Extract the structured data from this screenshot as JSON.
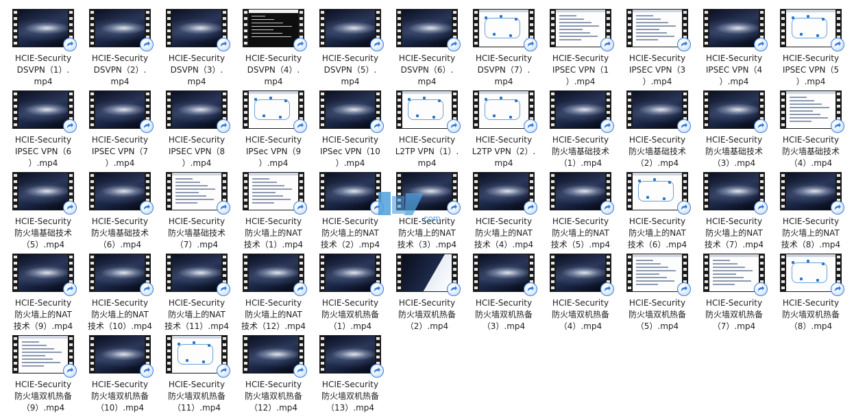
{
  "files": [
    {
      "lines": [
        "HCIE-Security",
        "DSVPN（1）.",
        "mp4"
      ],
      "thumb": "galaxy"
    },
    {
      "lines": [
        "HCIE-Security",
        "DSVPN（2）.",
        "mp4"
      ],
      "thumb": "galaxy"
    },
    {
      "lines": [
        "HCIE-Security",
        "DSVPN（3）.",
        "mp4"
      ],
      "thumb": "galaxy"
    },
    {
      "lines": [
        "HCIE-Security",
        "DSVPN（4）.",
        "mp4"
      ],
      "thumb": "terminal"
    },
    {
      "lines": [
        "HCIE-Security",
        "DSVPN（5）.",
        "mp4"
      ],
      "thumb": "galaxy"
    },
    {
      "lines": [
        "HCIE-Security",
        "DSVPN（6）.",
        "mp4"
      ],
      "thumb": "galaxy"
    },
    {
      "lines": [
        "HCIE-Security",
        "DSVPN（7）.",
        "mp4"
      ],
      "thumb": "diagram"
    },
    {
      "lines": [
        "HCIE-Security",
        "IPSEC VPN（1",
        "）.mp4"
      ],
      "thumb": "document"
    },
    {
      "lines": [
        "HCIE-Security",
        "IPSEC VPN（3",
        "）.mp4"
      ],
      "thumb": "document"
    },
    {
      "lines": [
        "HCIE-Security",
        "IPSEC VPN（4",
        "）.mp4"
      ],
      "thumb": "galaxy"
    },
    {
      "lines": [
        "HCIE-Security",
        "IPSEC VPN（5",
        "）.mp4"
      ],
      "thumb": "diagram"
    },
    {
      "lines": [
        "HCIE-Security",
        "IPSEC VPN（6",
        "）.mp4"
      ],
      "thumb": "galaxy"
    },
    {
      "lines": [
        "HCIE-Security",
        "IPSEC VPN（7",
        "）.mp4"
      ],
      "thumb": "galaxy"
    },
    {
      "lines": [
        "HCIE-Security",
        "IPSEC VPN（8",
        "）.mp4"
      ],
      "thumb": "galaxy"
    },
    {
      "lines": [
        "HCIE-Security",
        "IPSec VPN（9",
        "）.mp4"
      ],
      "thumb": "diagram"
    },
    {
      "lines": [
        "HCIE-Security",
        "IPSec VPN（10",
        "）.mp4"
      ],
      "thumb": "galaxy"
    },
    {
      "lines": [
        "HCIE-Security",
        "L2TP VPN（1）.",
        "mp4"
      ],
      "thumb": "diagram"
    },
    {
      "lines": [
        "HCIE-Security",
        "L2TP VPN（2）.",
        "mp4"
      ],
      "thumb": "diagram"
    },
    {
      "lines": [
        "HCIE-Security",
        "防火墙基础技术",
        "（1）.mp4"
      ],
      "thumb": "galaxy"
    },
    {
      "lines": [
        "HCIE-Security",
        "防火墙基础技术",
        "（2）.mp4"
      ],
      "thumb": "galaxy"
    },
    {
      "lines": [
        "HCIE-Security",
        "防火墙基础技术",
        "（3）.mp4"
      ],
      "thumb": "galaxy"
    },
    {
      "lines": [
        "HCIE-Security",
        "防火墙基础技术",
        "（4）.mp4"
      ],
      "thumb": "document"
    },
    {
      "lines": [
        "HCIE-Security",
        "防火墙基础技术",
        "（5）.mp4"
      ],
      "thumb": "galaxy"
    },
    {
      "lines": [
        "HCIE-Security",
        "防火墙基础技术",
        "（6）.mp4"
      ],
      "thumb": "galaxy"
    },
    {
      "lines": [
        "HCIE-Security",
        "防火墙基础技术",
        "（7）.mp4"
      ],
      "thumb": "document"
    },
    {
      "lines": [
        "HCIE-Security",
        "防火墙上的NAT",
        "技术（1）.mp4"
      ],
      "thumb": "document"
    },
    {
      "lines": [
        "HCIE-Security",
        "防火墙上的NAT",
        "技术（2）.mp4"
      ],
      "thumb": "galaxy"
    },
    {
      "lines": [
        "HCIE-Security",
        "防火墙上的NAT",
        "技术（3）.mp4"
      ],
      "thumb": "galaxy"
    },
    {
      "lines": [
        "HCIE-Security",
        "防火墙上的NAT",
        "技术（4）.mp4"
      ],
      "thumb": "galaxy"
    },
    {
      "lines": [
        "HCIE-Security",
        "防火墙上的NAT",
        "技术（5）.mp4"
      ],
      "thumb": "galaxy"
    },
    {
      "lines": [
        "HCIE-Security",
        "防火墙上的NAT",
        "技术（6）.mp4"
      ],
      "thumb": "diagram"
    },
    {
      "lines": [
        "HCIE-Security",
        "防火墙上的NAT",
        "技术（7）.mp4"
      ],
      "thumb": "galaxy"
    },
    {
      "lines": [
        "HCIE-Security",
        "防火墙上的NAT",
        "技术（8）.mp4"
      ],
      "thumb": "galaxy"
    },
    {
      "lines": [
        "HCIE-Security",
        "防火墙上的NAT",
        "技术（9）.mp4"
      ],
      "thumb": "galaxy"
    },
    {
      "lines": [
        "HCIE-Security",
        "防火墙上的NAT",
        "技术（10）.mp4"
      ],
      "thumb": "galaxy"
    },
    {
      "lines": [
        "HCIE-Security",
        "防火墙上的NAT",
        "技术（11）.mp4"
      ],
      "thumb": "galaxy"
    },
    {
      "lines": [
        "HCIE-Security",
        "防火墙上的NAT",
        "技术（12）.mp4"
      ],
      "thumb": "galaxy"
    },
    {
      "lines": [
        "HCIE-Security",
        "防火墙双机热备",
        "（1）.mp4"
      ],
      "thumb": "galaxy"
    },
    {
      "lines": [
        "HCIE-Security",
        "防火墙双机热备",
        "（2）.mp4"
      ],
      "thumb": "dark"
    },
    {
      "lines": [
        "HCIE-Security",
        "防火墙双机热备",
        "（3）.mp4"
      ],
      "thumb": "galaxy"
    },
    {
      "lines": [
        "HCIE-Security",
        "防火墙双机热备",
        "（4）.mp4"
      ],
      "thumb": "galaxy"
    },
    {
      "lines": [
        "HCIE-Security",
        "防火墙双机热备",
        "（5）.mp4"
      ],
      "thumb": "document"
    },
    {
      "lines": [
        "HCIE-Security",
        "防火墙双机热备",
        "（7）.mp4"
      ],
      "thumb": "document"
    },
    {
      "lines": [
        "HCIE-Security",
        "防火墙双机热备",
        "（8）.mp4"
      ],
      "thumb": "diagram"
    },
    {
      "lines": [
        "HCIE-Security",
        "防火墙双机热备",
        "（9）.mp4"
      ],
      "thumb": "document"
    },
    {
      "lines": [
        "HCIE-Security",
        "防火墙双机热备",
        "（10）.mp4"
      ],
      "thumb": "galaxy"
    },
    {
      "lines": [
        "HCIE-Security",
        "防火墙双机热备",
        "（11）.mp4"
      ],
      "thumb": "diagram"
    },
    {
      "lines": [
        "HCIE-Security",
        "防火墙双机热备",
        "（12）.mp4"
      ],
      "thumb": "galaxy"
    },
    {
      "lines": [
        "HCIE-Security",
        "防火墙双机热备",
        "（13）.mp4"
      ],
      "thumb": "galaxy"
    }
  ],
  "watermark": {
    "text": "com"
  },
  "colors": {
    "badge_ring": "#3b7ed8",
    "watermark": "#5aa7e0"
  },
  "icons": {
    "badge": "video-play-badge-icon"
  }
}
